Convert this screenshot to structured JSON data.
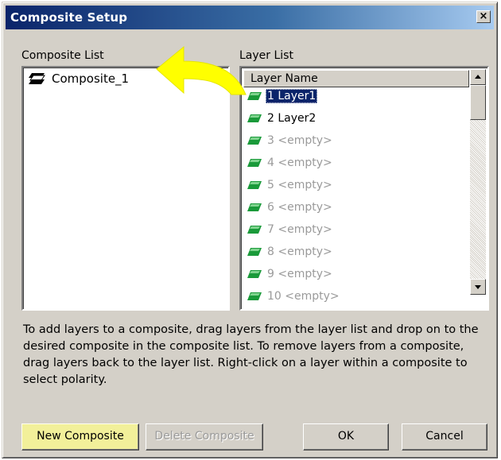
{
  "window": {
    "title": "Composite Setup",
    "close_label": "×"
  },
  "composite_panel": {
    "label": "Composite List",
    "items": [
      {
        "name": "Composite_1",
        "icon": "composite-layers-icon"
      }
    ]
  },
  "layer_panel": {
    "label": "Layer List",
    "column_header": "Layer Name",
    "layers": [
      {
        "text": "1 Layer1",
        "state": "selected"
      },
      {
        "text": "2 Layer2",
        "state": "normal"
      },
      {
        "text": "3 <empty>",
        "state": "empty"
      },
      {
        "text": "4 <empty>",
        "state": "empty"
      },
      {
        "text": "5 <empty>",
        "state": "empty"
      },
      {
        "text": "6 <empty>",
        "state": "empty"
      },
      {
        "text": "7 <empty>",
        "state": "empty"
      },
      {
        "text": "8 <empty>",
        "state": "empty"
      },
      {
        "text": "9 <empty>",
        "state": "empty"
      },
      {
        "text": "10 <empty>",
        "state": "empty"
      }
    ]
  },
  "instructions": "To add layers to a composite, drag layers from the layer list and drop on to the desired composite in the composite list.  To remove layers from a composite, drag layers back to the layer list.  Right-click on a layer within a composite to select polarity.",
  "buttons": {
    "new_composite": "New Composite",
    "delete_composite": "Delete Composite",
    "ok": "OK",
    "cancel": "Cancel"
  },
  "colors": {
    "title_bar": "#0a246a",
    "selection": "#0a246a",
    "layer_icon": "#1a9a3a",
    "annotation_arrow": "#ffff00",
    "highlight_button": "#f2f09a"
  }
}
